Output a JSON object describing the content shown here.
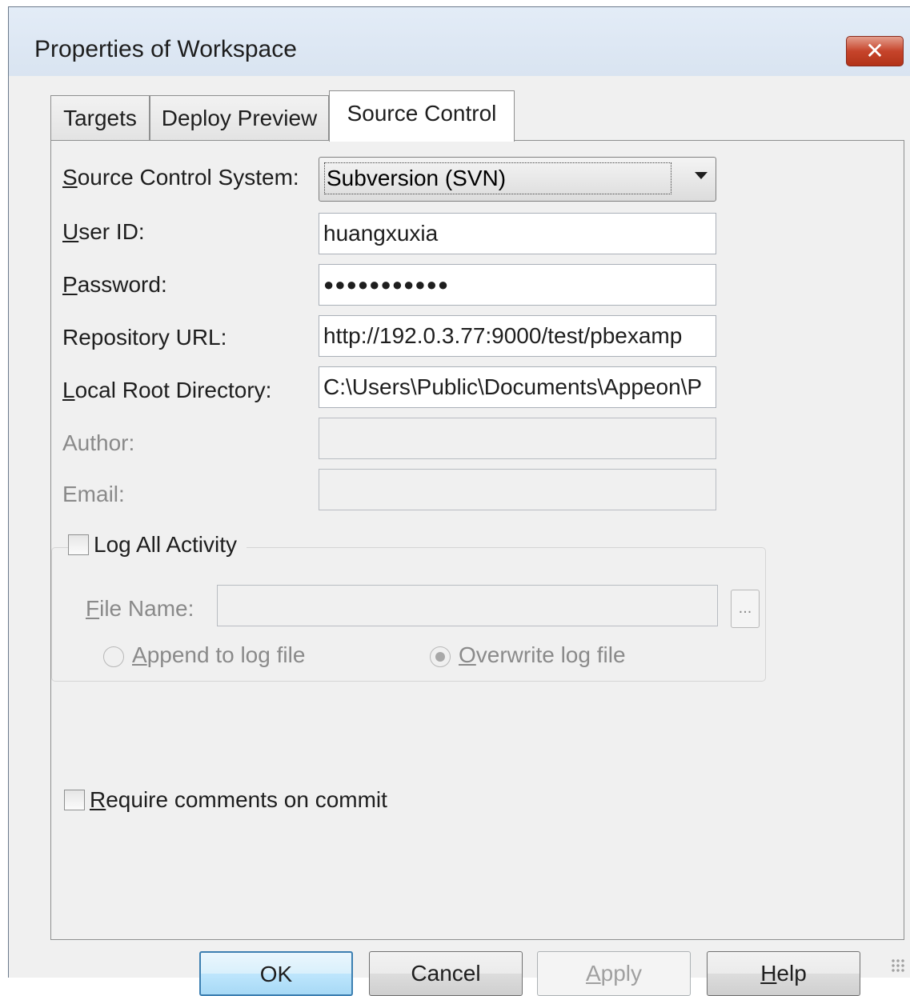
{
  "window": {
    "title": "Properties of Workspace",
    "close_glyph": "✕"
  },
  "tabs": [
    {
      "label": "Targets"
    },
    {
      "label": "Deploy Preview"
    },
    {
      "label": "Source Control"
    }
  ],
  "form": {
    "source_control_system": {
      "label_first": "S",
      "label_rest": "ource Control System:",
      "value": "Subversion (SVN)"
    },
    "user_id": {
      "label_first": "U",
      "label_rest": "ser ID:",
      "value": "huangxuxia"
    },
    "password": {
      "label_first": "P",
      "label_rest": "assword:",
      "value": "●●●●●●●●●●●"
    },
    "repository_url": {
      "label": "Repository URL:",
      "value": "http://192.0.3.77:9000/test/pbexamp"
    },
    "local_root": {
      "label_first": "L",
      "label_rest": "ocal Root Directory:",
      "value": "C:\\Users\\Public\\Documents\\Appeon\\P"
    },
    "author": {
      "label": "Author:",
      "value": ""
    },
    "email": {
      "label": "Email:",
      "value": ""
    }
  },
  "log_group": {
    "checkbox_label_pre": "Lo",
    "checkbox_label_ul": "g",
    "checkbox_label_post": " All Activity",
    "file_name_label_first": "F",
    "file_name_label_rest": "ile Name:",
    "file_name_value": "",
    "browse_label": "...",
    "append_first": "A",
    "append_rest": "ppend to log file",
    "overwrite_first": "O",
    "overwrite_rest": "verwrite log file"
  },
  "require_comments": {
    "label_first": "R",
    "label_rest": "equire comments on commit"
  },
  "buttons": {
    "ok": "OK",
    "cancel": "Cancel",
    "apply_first": "A",
    "apply_rest": "pply",
    "help_first": "H",
    "help_rest": "elp"
  }
}
